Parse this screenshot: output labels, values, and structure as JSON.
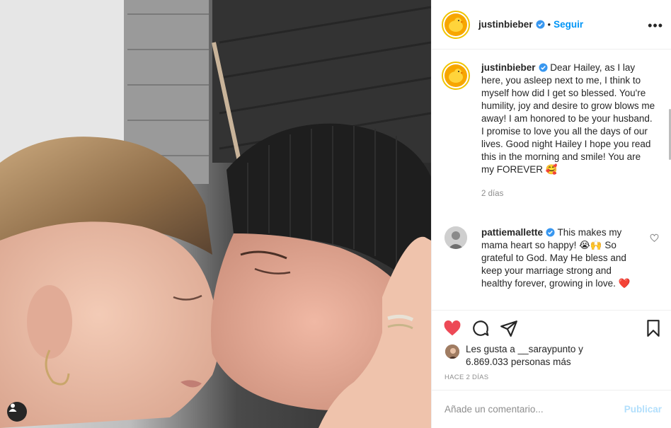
{
  "post": {
    "image_alt": "Photo"
  },
  "header": {
    "username": "justinbieber",
    "separator": "•",
    "follow_label": "Seguir",
    "more_label": "•••"
  },
  "caption": {
    "username": "justinbieber",
    "text": "Dear Hailey, as I lay here, you asleep next to me, I think to myself how did I get so blessed. You're humility, joy and desire to grow blows me away! I am honored to be your husband. I promise to love you all the days of our lives. Good night Hailey I hope you read this in the morning and smile! You are my FOREVER 🥰",
    "time_ago": "2 días"
  },
  "comments": [
    {
      "username": "pattiemallette",
      "text": "This makes my mama heart so happy! 😭🙌 So grateful to God. May He bless and keep your marriage strong and healthy forever, growing in love. ❤️"
    }
  ],
  "likes": {
    "prefix": "Les gusta a ",
    "liker": "__saraypunto",
    "middle": " y ",
    "count": "6.869.033",
    "suffix": " personas más"
  },
  "posted_time": "HACE 2 DÍAS",
  "add_comment": {
    "placeholder": "Añade un comentario...",
    "publish_label": "Publicar"
  },
  "colors": {
    "accent": "#0095f6",
    "like_red": "#ed4956",
    "muted": "#8e8e8e",
    "publish_disabled": "#b2dffc"
  },
  "icons": {
    "verified": "verified-badge-icon",
    "heart": "heart-filled-icon",
    "comment": "comment-icon",
    "share": "paper-plane-icon",
    "save": "bookmark-icon",
    "more": "ellipsis-icon",
    "tag": "user-tag-icon"
  }
}
